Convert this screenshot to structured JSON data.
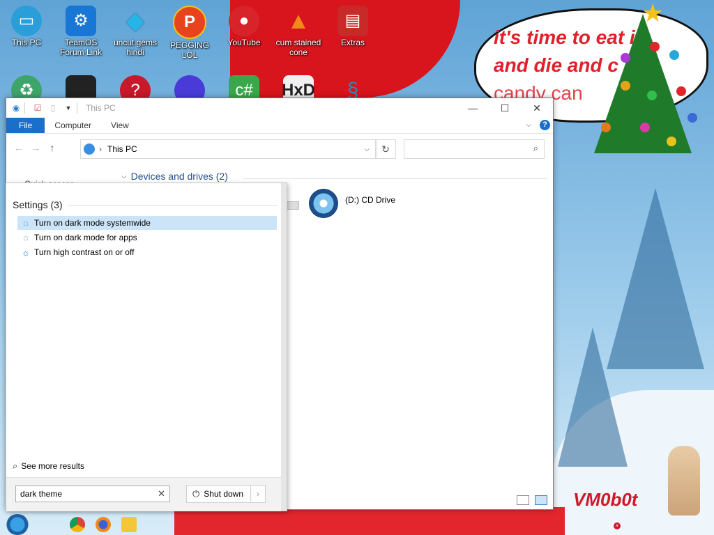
{
  "desktop": {
    "icons": [
      {
        "label": "This PC",
        "icon": "monitor-icon",
        "color": "#2a9ed8"
      },
      {
        "label": "TeamOS Forum Link",
        "icon": "gear-icon",
        "color": "#1877d4"
      },
      {
        "label": "uncut gems hindi",
        "icon": "diamond-icon",
        "color": "#27b5e8"
      },
      {
        "label": "PEGGING LOL",
        "icon": "p-logo-icon",
        "color": "#e8431c"
      },
      {
        "label": "YouTube",
        "icon": "angry-bird-icon",
        "color": "#d6242a"
      },
      {
        "label": "cum stained cone",
        "icon": "vlc-cone-icon",
        "color": "#f08a1a"
      },
      {
        "label": "Extras",
        "icon": "book-icon",
        "color": "#c82a2a"
      }
    ],
    "speech_bubble": {
      "line1": "it's time to eat it",
      "line2": "and die and c",
      "line3": "candy can"
    },
    "watermark": "VM0b0t"
  },
  "explorer": {
    "title": "This PC",
    "ribbon_tabs": [
      "File",
      "Computer",
      "View"
    ],
    "help_label": "?",
    "address_crumb": "This PC",
    "search_placeholder": "",
    "quick_access": "Quick access",
    "group_header": "Devices and drives (2)",
    "drive_label": "(D:) CD Drive"
  },
  "start_search": {
    "section_header": "Settings (3)",
    "results": [
      {
        "label": "Turn on dark mode systemwide",
        "icon": "palette-icon",
        "selected": true
      },
      {
        "label": "Turn on dark mode for apps",
        "icon": "palette-icon",
        "selected": false
      },
      {
        "label": "Turn high contrast on or off",
        "icon": "brightness-icon",
        "selected": false
      }
    ],
    "see_more": "See more results",
    "query": "dark theme",
    "shutdown_label": "Shut down"
  },
  "taskbar": {
    "apps": [
      "chrome-icon",
      "firefox-icon",
      "file-explorer-icon"
    ]
  },
  "colors": {
    "accent": "#1a6fc9",
    "selection": "#cce4f7",
    "group_header": "#1e4e8c"
  }
}
